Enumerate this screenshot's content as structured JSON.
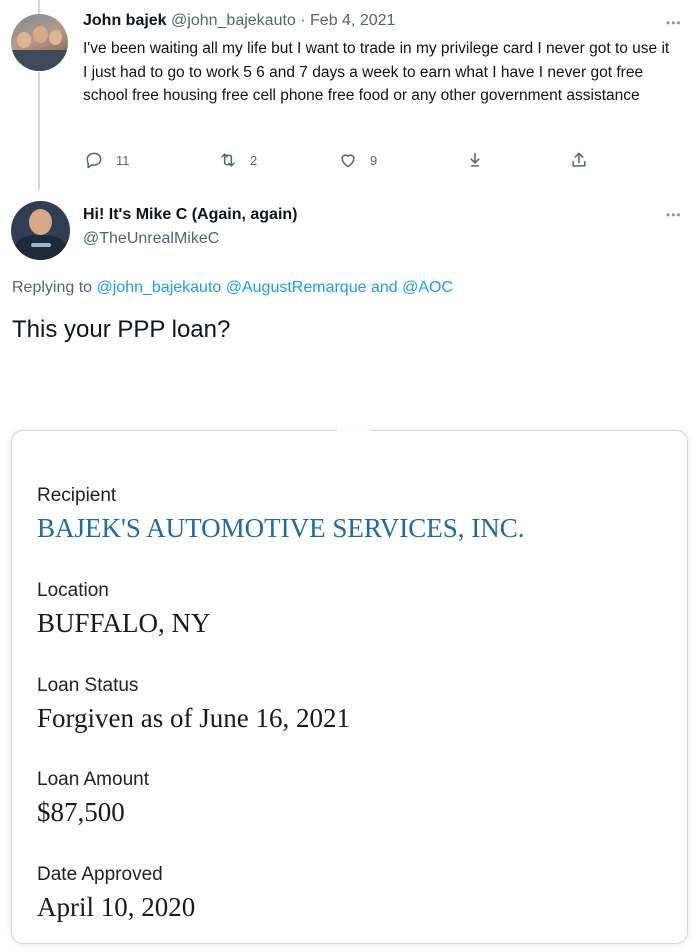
{
  "tweet1": {
    "name": "John bajek",
    "handle": "@john_bajekauto",
    "separator": " · ",
    "date": "Feb 4, 2021",
    "text": "I've been waiting all my life but I want to trade in my privilege card I never got to use it I just had to go to work 5 6 and 7 days a week to earn what I have I never got free school free housing free cell phone free food or any other government assistance",
    "reply_count": "11",
    "retweet_count": "2",
    "like_count": "9",
    "icons": [
      "reply-icon",
      "retweet-icon",
      "like-icon",
      "download-icon",
      "share-icon",
      "more-icon"
    ]
  },
  "tweet2": {
    "name": "Hi! It's Mike C (Again, again)",
    "handle": "@TheUnrealMikeC",
    "replying_prefix": "Replying to ",
    "mentions_text": "@john_bajekauto @AugustRemarque and @AOC",
    "text": "This your PPP loan?"
  },
  "loan_card": {
    "recipient_label": "Recipient",
    "recipient_value": "BAJEK'S AUTOMOTIVE SERVICES, INC.",
    "location_label": "Location",
    "location_value": "BUFFALO, NY",
    "status_label": "Loan Status",
    "status_value": "Forgiven as of June 16, 2021",
    "amount_label": "Loan Amount",
    "amount_value": "$87,500",
    "date_label": "Date Approved",
    "date_value": "April 10, 2020"
  },
  "colors": {
    "link": "#1d9bf0",
    "muted": "#536471",
    "recipient": "#1f6aa5"
  }
}
